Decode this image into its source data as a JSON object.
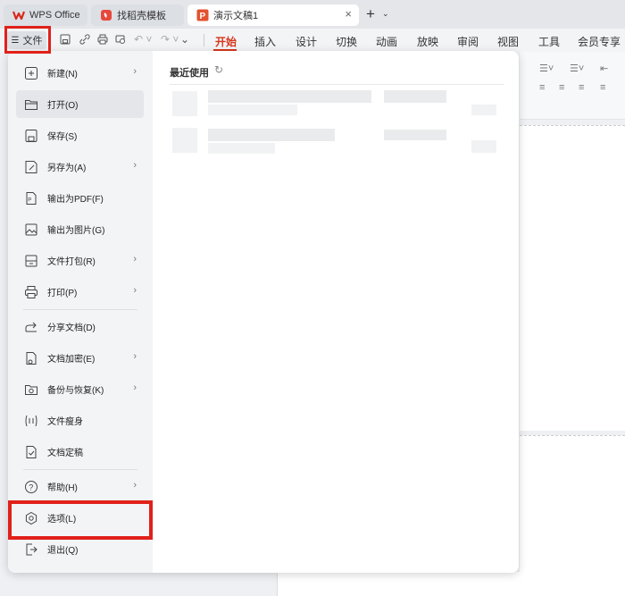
{
  "tabs": [
    {
      "label": "WPS Office",
      "icon": "wps-logo-icon"
    },
    {
      "label": "找稻壳模板",
      "icon": "docer-icon"
    },
    {
      "label": "演示文稿1",
      "icon": "presentation-icon",
      "close": "×"
    }
  ],
  "toolbar": {
    "file_label": "文件",
    "ribbon_tabs": [
      "开始",
      "插入",
      "设计",
      "切换",
      "动画",
      "放映",
      "审阅",
      "视图",
      "工具",
      "会员专享"
    ],
    "active_tab": "开始"
  },
  "menu": {
    "items": [
      {
        "label": "新建(N)",
        "icon": "new-icon",
        "submenu": true
      },
      {
        "label": "打开(O)",
        "icon": "open-folder-icon",
        "submenu": false
      },
      {
        "label": "保存(S)",
        "icon": "save-icon",
        "submenu": false
      },
      {
        "label": "另存为(A)",
        "icon": "save-as-icon",
        "submenu": true
      },
      {
        "label": "输出为PDF(F)",
        "icon": "pdf-icon",
        "submenu": false
      },
      {
        "label": "输出为图片(G)",
        "icon": "image-icon",
        "submenu": false
      },
      {
        "label": "文件打包(R)",
        "icon": "package-icon",
        "submenu": true
      },
      {
        "label": "打印(P)",
        "icon": "print-icon",
        "submenu": true
      },
      {
        "label": "分享文档(D)",
        "icon": "share-icon",
        "submenu": false
      },
      {
        "label": "文档加密(E)",
        "icon": "encrypt-icon",
        "submenu": true
      },
      {
        "label": "备份与恢复(K)",
        "icon": "backup-icon",
        "submenu": true
      },
      {
        "label": "文件瘦身",
        "icon": "slim-icon",
        "submenu": false
      },
      {
        "label": "文档定稿",
        "icon": "finalize-icon",
        "submenu": false
      },
      {
        "label": "帮助(H)",
        "icon": "help-icon",
        "submenu": true
      },
      {
        "label": "选项(L)",
        "icon": "options-icon",
        "submenu": false
      },
      {
        "label": "退出(Q)",
        "icon": "exit-icon",
        "submenu": false
      }
    ],
    "recent_title": "最近使用"
  },
  "colors": {
    "accent": "#d6361c",
    "highlight": "#e0211a"
  }
}
